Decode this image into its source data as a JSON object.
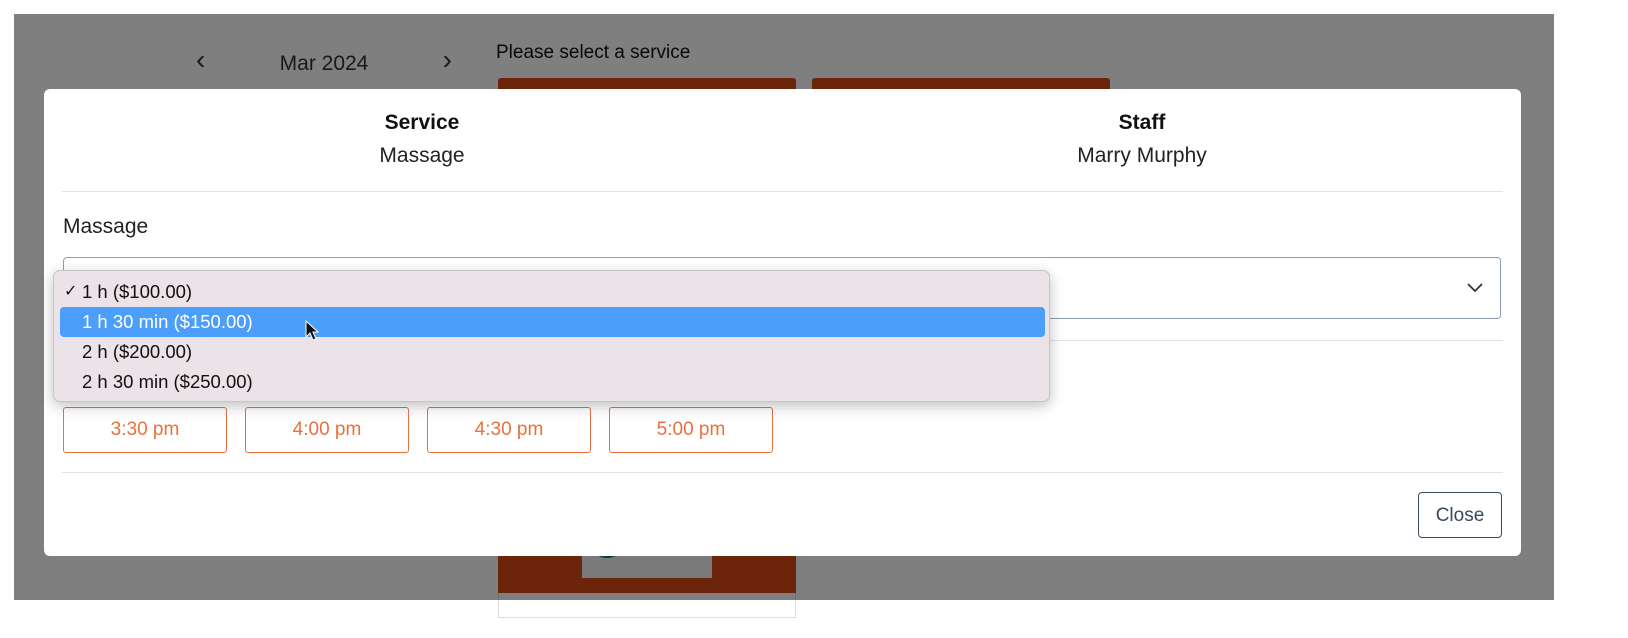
{
  "background": {
    "month_label": "Mar 2024",
    "prompt": "Please select a service"
  },
  "modal": {
    "service_title": "Service",
    "service_value": "Massage",
    "staff_title": "Staff",
    "staff_value": "Marry Murphy",
    "section_label": "Massage",
    "time_slots": [
      "3:30 pm",
      "4:00 pm",
      "4:30 pm",
      "5:00 pm"
    ],
    "close_label": "Close"
  },
  "dropdown": {
    "options": [
      {
        "label": "1 h ($100.00)",
        "checked": "✓"
      },
      {
        "label": "1 h 30 min ($150.00)",
        "checked": ""
      },
      {
        "label": "2 h ($200.00)",
        "checked": ""
      },
      {
        "label": "2 h 30 min ($250.00)",
        "checked": ""
      }
    ]
  },
  "colors": {
    "slot_accent": "#e8703e",
    "highlight": "#4b9ffa",
    "service_card": "#d94a14"
  }
}
